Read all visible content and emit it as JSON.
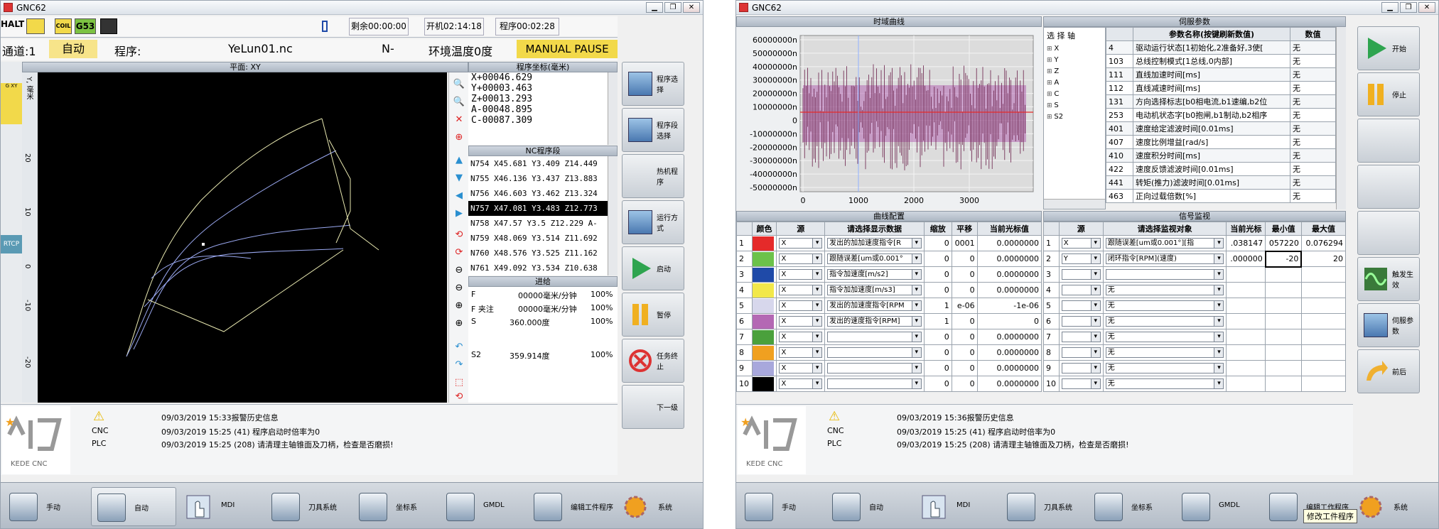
{
  "left": {
    "title": "GNC62",
    "status": {
      "halt": "HALT",
      "coil": "COIL",
      "g53": "G53",
      "remain": "剩余00:00:00",
      "power_on": "开机02:14:18",
      "prog_time": "程序00:02:28"
    },
    "info": {
      "channel": "通道:1",
      "mode": "自动",
      "prog_label": "程序:",
      "prog_name": "YeLun01.nc",
      "n": "N-",
      "temp": "环境温度0度",
      "state": "MANUAL PAUSE"
    },
    "plot_title": "平面: XY",
    "y_label": "Y, 毫米",
    "y_ticks": [
      "20",
      "10",
      "0",
      "-10",
      "-20"
    ],
    "side_tags": {
      "gxy": "G XY",
      "rtcp": "RTCP"
    },
    "coord_title": "程序坐标(毫米)",
    "coords": [
      "X+00046.629",
      "Y+00003.463",
      "Z+00013.293",
      "A-00048.895",
      "C-00087.309"
    ],
    "nc_title": "NC程序段",
    "nc_lines": [
      "N754 X45.681 Y3.409 Z14.449",
      "N755 X46.136 Y3.437 Z13.883",
      "N756 X46.603 Y3.462 Z13.324",
      "N757 X47.081 Y3.483 Z12.773",
      "N758 X47.57 Y3.5 Z12.229 A-",
      "N759 X48.069 Y3.514 Z11.692",
      "N760 X48.576 Y3.525 Z11.162",
      "N761 X49.092 Y3.534 Z10.638"
    ],
    "feed_title": "进给",
    "feeds": [
      {
        "k": "F",
        "v": "00000毫米/分钟",
        "p": "100%"
      },
      {
        "k": "F 夹注",
        "v": "00000毫米/分钟",
        "p": "100%"
      },
      {
        "k": "S",
        "v": "360.000度",
        "p": "100%"
      },
      {
        "k": "S2",
        "v": "359.914度",
        "p": "100%"
      }
    ],
    "side_buttons": [
      "程序选择",
      "程序段选择",
      "热机程序",
      "运行方式",
      "启动",
      "暂停",
      "任务终止",
      "下一级"
    ],
    "alarm": {
      "header": "09/03/2019 15:33报警历史信息",
      "lines": [
        {
          "src": "CNC",
          "text": "09/03/2019 15:25 (41) 程序启动时倍率为0"
        },
        {
          "src": "PLC",
          "text": "09/03/2019 15:25 (208) 请清理主轴锥面及刀柄，检查是否磨损!"
        }
      ],
      "logo": "KEDE CNC"
    },
    "bottom": [
      "手动",
      "自动",
      "MDI",
      "刀具系统",
      "坐标系",
      "GMDL",
      "编辑工件程序",
      "系统"
    ]
  },
  "right": {
    "title": "GNC62",
    "chart_title": "时域曲线",
    "chart_data": {
      "type": "line",
      "y_ticks": [
        "60000000n",
        "50000000n",
        "40000000n",
        "30000000n",
        "20000000n",
        "10000000n",
        "0",
        "-10000000n",
        "-20000000n",
        "-30000000n",
        "-40000000n",
        "-50000000n"
      ],
      "x_ticks": [
        "0",
        "1000",
        "2000",
        "3000"
      ],
      "ylim": [
        -55000000,
        65000000
      ],
      "xlim": [
        0,
        4000
      ]
    },
    "servo_title": "伺服参数",
    "axis_title": "选 择 轴",
    "axes": [
      "X",
      "Y",
      "Z",
      "A",
      "C",
      "S",
      "S2"
    ],
    "param_head": {
      "name": "参数名称(按键刷新数值)",
      "value": "数值"
    },
    "params": [
      {
        "id": "4",
        "name": "驱动运行状态[1初始化,2准备好,3使[",
        "v": "无"
      },
      {
        "id": "103",
        "name": "总线控制模式[1总线,0内部]",
        "v": "无"
      },
      {
        "id": "111",
        "name": "直线加速时间[ms]",
        "v": "无"
      },
      {
        "id": "112",
        "name": "直线减速时间[ms]",
        "v": "无"
      },
      {
        "id": "131",
        "name": "方向选择标志[b0相电流,b1速编,b2位",
        "v": "无"
      },
      {
        "id": "253",
        "name": "电动机状态字[b0抱闸,b1制动,b2相序",
        "v": "无"
      },
      {
        "id": "401",
        "name": "速度给定滤波时间[0.01ms]",
        "v": "无"
      },
      {
        "id": "407",
        "name": "速度比例增益[rad/s]",
        "v": "无"
      },
      {
        "id": "410",
        "name": "速度积分时间[ms]",
        "v": "无"
      },
      {
        "id": "422",
        "name": "速度反馈滤波时间[0.01ms]",
        "v": "无"
      },
      {
        "id": "441",
        "name": "转矩(推力)滤波时间[0.01ms]",
        "v": "无"
      },
      {
        "id": "463",
        "name": "正向过载倍数[%]",
        "v": "无"
      }
    ],
    "curve_title": "曲线配置",
    "curve_head": [
      "颜色",
      "源",
      "请选择显示数据",
      "缩放",
      "平移",
      "当前光标值"
    ],
    "curves": [
      {
        "n": "1",
        "c": "#e52a2a",
        "src": "X",
        "data": "发出的加加速度指令[R",
        "s": "0",
        "o": "0001",
        "v": "0.0000000"
      },
      {
        "n": "2",
        "c": "#6cc24a",
        "src": "X",
        "data": "跟随误差[um或0.001°",
        "s": "0",
        "o": "0",
        "v": "0.0000000"
      },
      {
        "n": "3",
        "c": "#1f4aa8",
        "src": "X",
        "data": "指令加速度[m/s2]",
        "s": "0",
        "o": "0",
        "v": "0.0000000"
      },
      {
        "n": "4",
        "c": "#f2e84a",
        "src": "X",
        "data": "指令加加速度[m/s3]",
        "s": "0",
        "o": "0",
        "v": "0.0000000"
      },
      {
        "n": "5",
        "c": "#d7d7ec",
        "src": "X",
        "data": "发出的加速度指令[RPM",
        "s": "1",
        "o": "e-06",
        "v": "-1e-06"
      },
      {
        "n": "6",
        "c": "#b468b4",
        "src": "X",
        "data": "发出的速度指令[RPM]",
        "s": "1",
        "o": "0",
        "v": "0"
      },
      {
        "n": "7",
        "c": "#4aa03c",
        "src": "X",
        "data": "",
        "s": "0",
        "o": "0",
        "v": "0.0000000"
      },
      {
        "n": "8",
        "c": "#f0a020",
        "src": "X",
        "data": "",
        "s": "0",
        "o": "0",
        "v": "0.0000000"
      },
      {
        "n": "9",
        "c": "#a8a8dc",
        "src": "X",
        "data": "",
        "s": "0",
        "o": "0",
        "v": "0.0000000"
      },
      {
        "n": "10",
        "c": "#000000",
        "src": "X",
        "data": "",
        "s": "0",
        "o": "0",
        "v": "0.0000000"
      }
    ],
    "signal_title": "信号监视",
    "signal_head": [
      "源",
      "请选择监视对象",
      "当前光标",
      "最小值",
      "最大值"
    ],
    "signals": [
      {
        "n": "1",
        "src": "X",
        "obj": "跟随误差[um或0.001°][指",
        "cur": ".038147",
        "min": "057220",
        "max": "0.076294"
      },
      {
        "n": "2",
        "src": "Y",
        "obj": "闭环指令[RPM](速度)",
        "cur": ".000000",
        "min": "-20",
        "max": "20"
      },
      {
        "n": "3",
        "src": "",
        "obj": "",
        "cur": "",
        "min": "",
        "max": ""
      },
      {
        "n": "4",
        "src": "",
        "obj": "无",
        "cur": "",
        "min": "",
        "max": ""
      },
      {
        "n": "5",
        "src": "",
        "obj": "无",
        "cur": "",
        "min": "",
        "max": ""
      },
      {
        "n": "6",
        "src": "",
        "obj": "无",
        "cur": "",
        "min": "",
        "max": ""
      },
      {
        "n": "7",
        "src": "",
        "obj": "无",
        "cur": "",
        "min": "",
        "max": ""
      },
      {
        "n": "8",
        "src": "",
        "obj": "无",
        "cur": "",
        "min": "",
        "max": ""
      },
      {
        "n": "9",
        "src": "",
        "obj": "无",
        "cur": "",
        "min": "",
        "max": ""
      },
      {
        "n": "10",
        "src": "",
        "obj": "无",
        "cur": "",
        "min": "",
        "max": ""
      }
    ],
    "side_buttons": [
      "开始",
      "停止",
      "",
      "",
      "",
      "触发生效",
      "伺服参数",
      "前后"
    ],
    "alarm": {
      "header": "09/03/2019 15:36报警历史信息",
      "lines": [
        {
          "src": "CNC",
          "text": "09/03/2019 15:25 (41) 程序启动时倍率为0"
        },
        {
          "src": "PLC",
          "text": "09/03/2019 15:25 (208) 请清理主轴锥面及刀柄，检查是否磨损!"
        }
      ],
      "logo": "KEDE CNC"
    },
    "bottom": [
      "手动",
      "自动",
      "MDI",
      "刀具系统",
      "坐标系",
      "GMDL",
      "编辑工作程序",
      "系统"
    ],
    "tooltip": "修改工件程序"
  }
}
